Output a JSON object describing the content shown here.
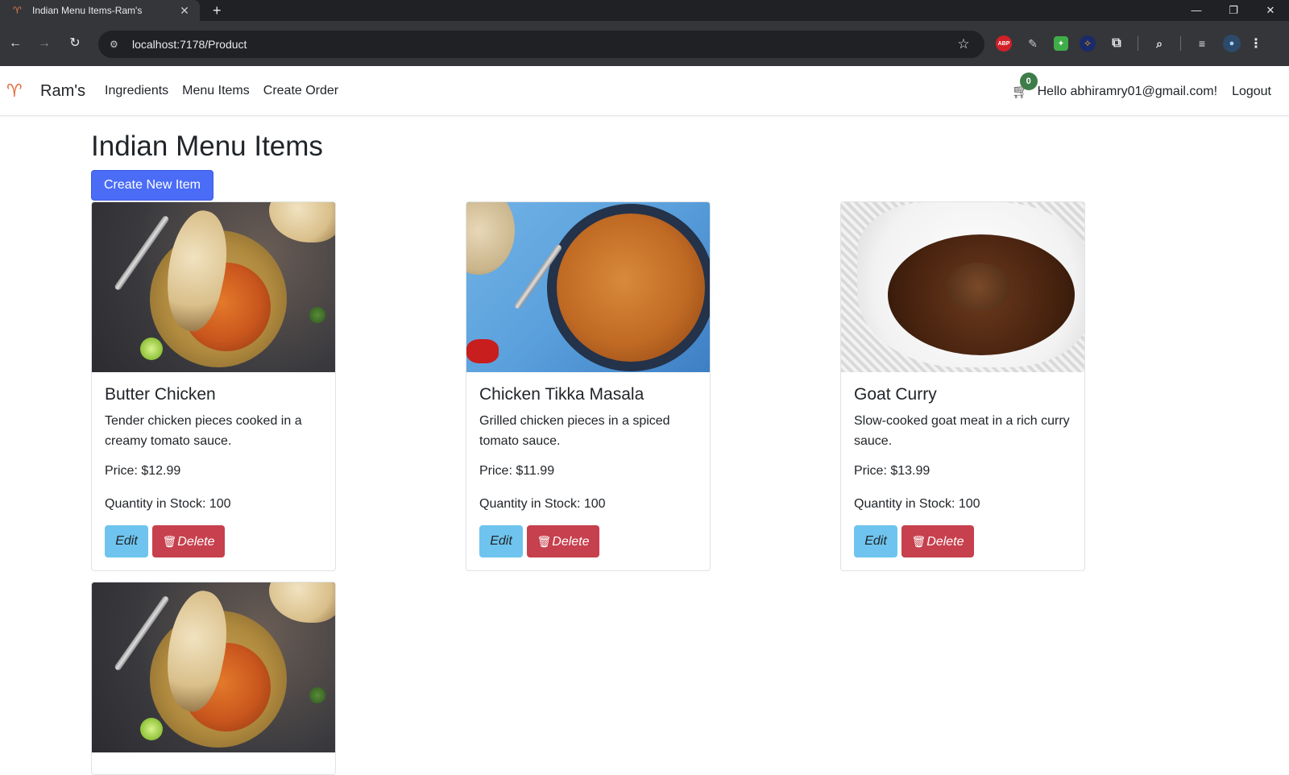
{
  "browser": {
    "tab_title": "Indian Menu Items-Ram's",
    "url": "localhost:7178/Product"
  },
  "navbar": {
    "brand": "Ram's",
    "links": [
      "Ingredients",
      "Menu Items",
      "Create Order"
    ],
    "cart_count": "0",
    "greeting": "Hello abhiramry01@gmail.com!",
    "logout": "Logout"
  },
  "page": {
    "title": "Indian Menu Items",
    "create_button": "Create New Item"
  },
  "items": [
    {
      "name": "Butter Chicken",
      "description": "Tender chicken pieces cooked in a creamy tomato sauce.",
      "price": "Price: $12.99",
      "quantity": "Quantity in Stock: 100",
      "edit": "Edit",
      "delete": "Delete"
    },
    {
      "name": "Chicken Tikka Masala",
      "description": "Grilled chicken pieces in a spiced tomato sauce.",
      "price": "Price: $11.99",
      "quantity": "Quantity in Stock: 100",
      "edit": "Edit",
      "delete": "Delete"
    },
    {
      "name": "Goat Curry",
      "description": "Slow-cooked goat meat in a rich curry sauce.",
      "price": "Price: $13.99",
      "quantity": "Quantity in Stock: 100",
      "edit": "Edit",
      "delete": "Delete"
    }
  ],
  "colors": {
    "primary": "#4a6cf7",
    "edit": "#6ec4ee",
    "delete": "#c7404d",
    "badge": "#3e7d4a"
  }
}
